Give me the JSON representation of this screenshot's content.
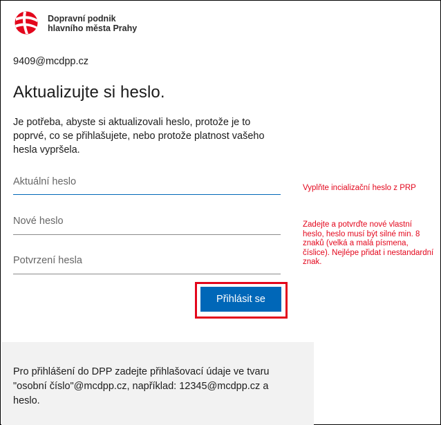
{
  "brand": {
    "line1": "Dopravní podnik",
    "line2": "hlavního města Prahy",
    "color": "#e3061c"
  },
  "user_email": "9409@mcdpp.cz",
  "title": "Aktualizujte si heslo.",
  "description": "Je potřeba, abyste si aktualizovali heslo, protože je to poprvé, co se přihlašujete, nebo protože platnost vašeho hesla vypršela.",
  "fields": {
    "current_password": {
      "placeholder": "Aktuální heslo",
      "value": ""
    },
    "new_password": {
      "placeholder": "Nové heslo",
      "value": ""
    },
    "confirm_password": {
      "placeholder": "Potvrzení hesla",
      "value": ""
    }
  },
  "submit_label": "Přihlásit se",
  "annotations": {
    "current_hint": "Vyplňte incializační heslo z PRP",
    "new_hint": "Zadejte a potvrďte nové vlastní heslo, heslo musí být silné min. 8 znaků (velká a malá písmena, číslice). Nejlépe přidat i nestandardní znak.",
    "color": "#e3061c"
  },
  "footer": {
    "text": "Pro přihlášení do DPP zadejte přihlašovací údaje ve tvaru \"osobní číslo\"@mcdpp.cz, například: 12345@mcdpp.cz a heslo."
  },
  "colors": {
    "accent": "#0067b8",
    "highlight": "#e3061c",
    "footer_bg": "#f2f2f2"
  }
}
